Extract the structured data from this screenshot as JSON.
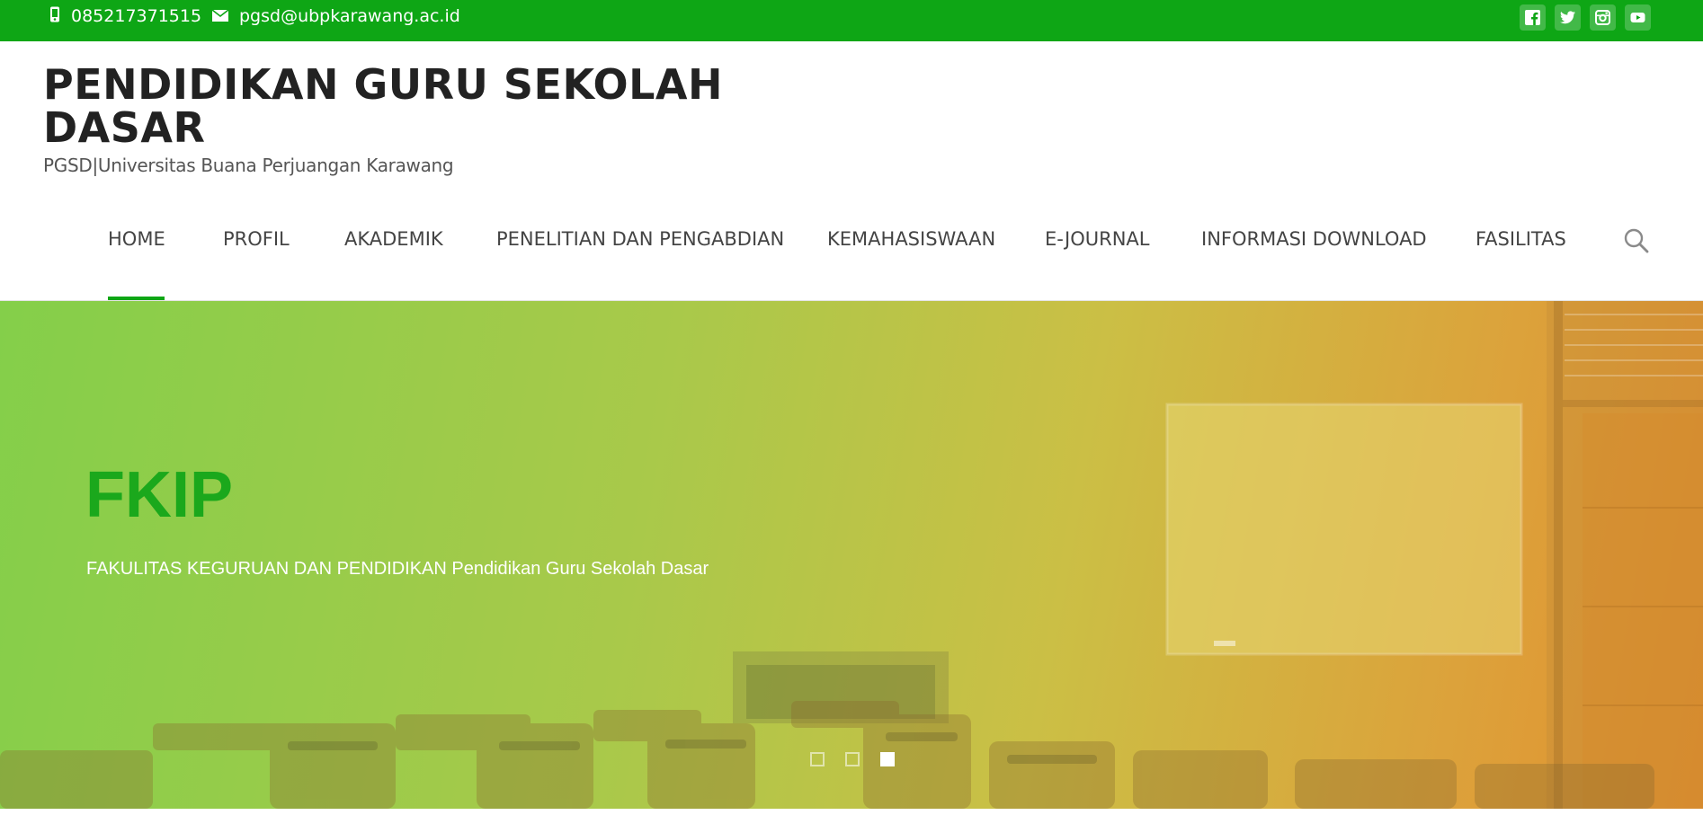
{
  "topbar": {
    "phone": "085217371515",
    "email": "pgsd@ubpkarawang.ac.id",
    "phone_icon": "mobile-phone-icon",
    "email_icon": "envelope-icon",
    "social": [
      {
        "name": "facebook",
        "icon": "facebook-icon"
      },
      {
        "name": "twitter",
        "icon": "twitter-icon"
      },
      {
        "name": "instagram",
        "icon": "instagram-icon"
      },
      {
        "name": "youtube",
        "icon": "youtube-icon"
      }
    ],
    "bg_color": "#0ea615"
  },
  "header": {
    "title": "PENDIDIKAN GURU SEKOLAH DASAR",
    "tagline": "PGSD|Universitas Buana Perjuangan Karawang"
  },
  "nav": {
    "items": [
      {
        "label": "HOME",
        "active": true
      },
      {
        "label": "PROFIL"
      },
      {
        "label": "AKADEMIK"
      },
      {
        "label": "PENELITIAN DAN PENGABDIAN"
      },
      {
        "label": "KEMAHASISWAAN"
      },
      {
        "label": "E-JOURNAL"
      },
      {
        "label": "INFORMASI DOWNLOAD"
      },
      {
        "label": "FASILITAS"
      }
    ],
    "search_icon": "search-icon",
    "accent_color": "#0ea615"
  },
  "hero": {
    "title": "FKIP",
    "subtitle": "FAKULITAS KEGURUAN DAN PENDIDIKAN Pendidikan Guru Sekolah Dasar",
    "slides_total": 3,
    "active_slide": 3,
    "title_color": "#1ba81c"
  }
}
